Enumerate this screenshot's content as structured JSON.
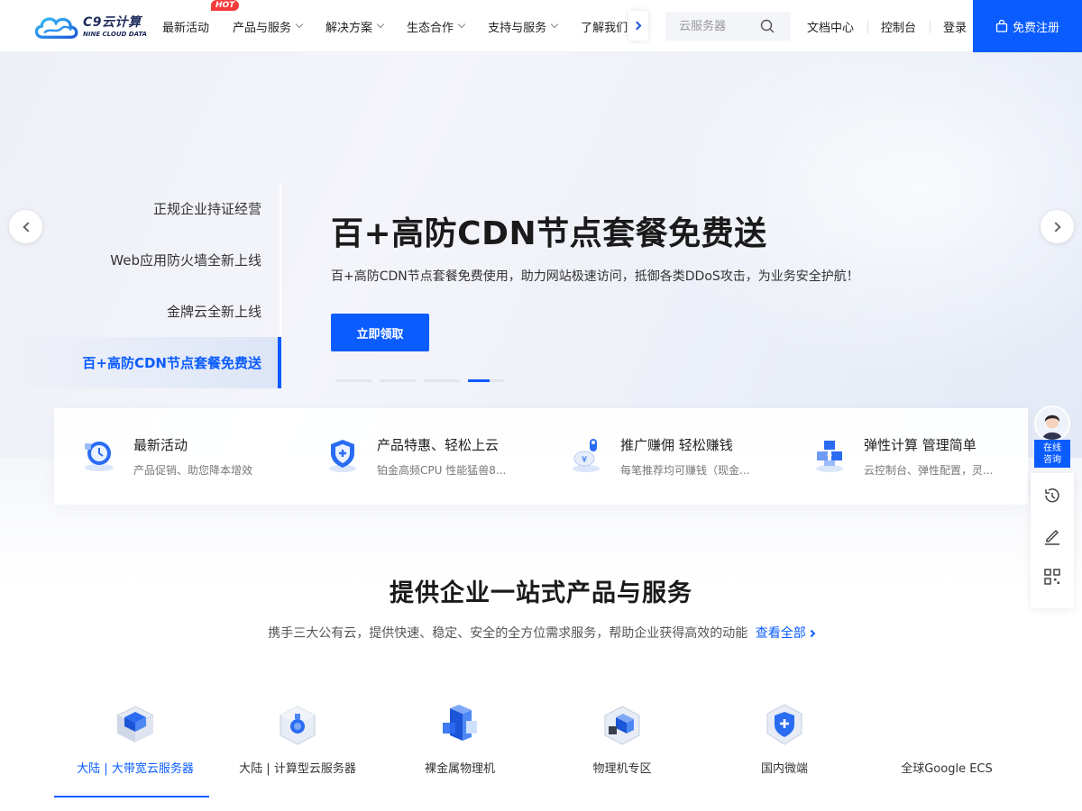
{
  "header": {
    "logo_main": "C9云计算",
    "logo_sub": "NINE CLOUD DATA",
    "hot_badge": "HOT",
    "nav": [
      {
        "label": "最新活动",
        "has_dropdown": false
      },
      {
        "label": "产品与服务",
        "has_dropdown": true
      },
      {
        "label": "解决方案",
        "has_dropdown": true
      },
      {
        "label": "生态合作",
        "has_dropdown": true
      },
      {
        "label": "支持与服务",
        "has_dropdown": true
      },
      {
        "label": "了解我们",
        "has_dropdown": false
      }
    ],
    "search_placeholder": "云服务器",
    "links": [
      "文档中心",
      "控制台",
      "登录"
    ],
    "register_label": "免费注册"
  },
  "hero": {
    "tabs": [
      "正规企业持证经营",
      "Web应用防火墙全新上线",
      "金牌云全新上线",
      "百+高防CDN节点套餐免费送"
    ],
    "active_tab": 3,
    "title": "百+高防CDN节点套餐免费送",
    "description": "百+高防CDN节点套餐免费使用，助力网站极速访问，抵御各类DDoS攻击，为业务安全护航！",
    "button_label": "立即领取",
    "slide_count": 4,
    "active_slide": 3
  },
  "features": [
    {
      "title": "最新活动",
      "subtitle": "产品促销、助您降本增效",
      "icon": "activity-icon"
    },
    {
      "title": "产品特惠、轻松上云",
      "subtitle": "铂金高频CPU 性能猛兽8...",
      "icon": "shield-plus-icon"
    },
    {
      "title": "推广赚佣 轻松赚钱",
      "subtitle": "每笔推荐均可赚钱（现金...",
      "icon": "coin-icon"
    },
    {
      "title": "弹性计算 管理简单",
      "subtitle": "云控制台、弹性配置，灵...",
      "icon": "cube-cluster-icon"
    }
  ],
  "section": {
    "title": "提供企业一站式产品与服务",
    "description": "携手三大公有云，提供快速、稳定、安全的全方位需求服务，帮助企业获得高效的动能",
    "view_all": "查看全部"
  },
  "product_tabs": [
    {
      "label": "大陆 | 大带宽云服务器",
      "icon": "server-box-icon"
    },
    {
      "label": "大陆 | 计算型云服务器",
      "icon": "compute-cube-icon"
    },
    {
      "label": "裸金属物理机",
      "icon": "bare-metal-icon"
    },
    {
      "label": "物理机专区",
      "icon": "physical-server-icon"
    },
    {
      "label": "国内微端",
      "icon": "micro-shield-icon"
    },
    {
      "label": "全球Google ECS",
      "icon": ""
    }
  ],
  "active_product_tab": 0,
  "side": {
    "online_label_1": "在线",
    "online_label_2": "咨询"
  },
  "colors": {
    "primary": "#0a5cff",
    "hot": "#f33b3b",
    "text": "#1f2430"
  }
}
